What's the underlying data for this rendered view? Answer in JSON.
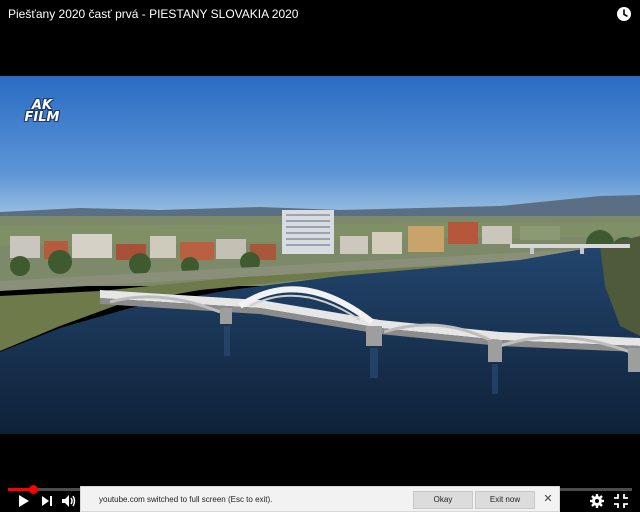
{
  "video": {
    "title": "Piešťany 2020 časť prvá - PIESTANY SLOVAKIA 2020",
    "watermark_line1": "AK",
    "watermark_line2": "FILM"
  },
  "controls": {
    "play_icon": "play-icon",
    "next_icon": "next-icon",
    "volume_icon": "volume-icon",
    "settings_icon": "gear-icon",
    "fullscreen_icon": "exit-fullscreen-icon",
    "watch_later_icon": "clock-icon",
    "progress_fraction": 0.04,
    "accent_color": "#ff0000"
  },
  "fullscreen_notice": {
    "message": "youtube.com switched to full screen (Esc to exit).",
    "okay_label": "Okay",
    "exit_label": "Exit now",
    "close_icon": "close-icon"
  }
}
